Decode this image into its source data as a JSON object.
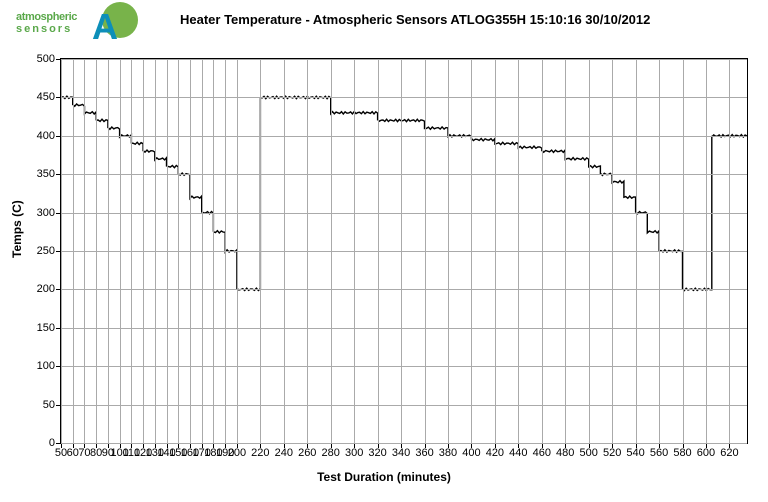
{
  "logo": {
    "word1": "atmospheric",
    "word2": "sensors",
    "letter": "A"
  },
  "chart_data": {
    "type": "line",
    "title": "Heater Temperature - Atmospheric Sensors ATLOG355H 15:10:16 30/10/2012",
    "xlabel": "Test Duration (minutes)",
    "ylabel": "Temps (C)",
    "xlim": [
      50,
      635
    ],
    "ylim": [
      0,
      500
    ],
    "x_ticks": [
      50,
      60,
      70,
      80,
      90,
      100,
      110,
      120,
      130,
      140,
      150,
      160,
      170,
      180,
      190,
      200,
      220,
      240,
      260,
      280,
      300,
      320,
      340,
      360,
      380,
      400,
      420,
      440,
      460,
      480,
      500,
      520,
      540,
      560,
      580,
      600,
      620
    ],
    "y_ticks": [
      0,
      50,
      100,
      150,
      200,
      250,
      300,
      350,
      400,
      450,
      500
    ],
    "grid": true,
    "series": [
      {
        "name": "Temp",
        "step_mode": true,
        "color": "#000000",
        "breakpoints": [
          {
            "x": 50,
            "y": 450
          },
          {
            "x": 60,
            "y": 440
          },
          {
            "x": 70,
            "y": 430
          },
          {
            "x": 80,
            "y": 420
          },
          {
            "x": 90,
            "y": 410
          },
          {
            "x": 100,
            "y": 400
          },
          {
            "x": 110,
            "y": 390
          },
          {
            "x": 120,
            "y": 380
          },
          {
            "x": 130,
            "y": 370
          },
          {
            "x": 140,
            "y": 360
          },
          {
            "x": 150,
            "y": 350
          },
          {
            "x": 160,
            "y": 320
          },
          {
            "x": 170,
            "y": 300
          },
          {
            "x": 180,
            "y": 275
          },
          {
            "x": 190,
            "y": 250
          },
          {
            "x": 200,
            "y": 200
          },
          {
            "x": 220,
            "y": 450
          },
          {
            "x": 280,
            "y": 430
          },
          {
            "x": 320,
            "y": 420
          },
          {
            "x": 360,
            "y": 410
          },
          {
            "x": 380,
            "y": 400
          },
          {
            "x": 400,
            "y": 395
          },
          {
            "x": 420,
            "y": 390
          },
          {
            "x": 440,
            "y": 385
          },
          {
            "x": 460,
            "y": 380
          },
          {
            "x": 480,
            "y": 370
          },
          {
            "x": 500,
            "y": 360
          },
          {
            "x": 510,
            "y": 350
          },
          {
            "x": 520,
            "y": 340
          },
          {
            "x": 530,
            "y": 320
          },
          {
            "x": 540,
            "y": 300
          },
          {
            "x": 550,
            "y": 275
          },
          {
            "x": 560,
            "y": 250
          },
          {
            "x": 580,
            "y": 200
          },
          {
            "x": 605,
            "y": 400
          },
          {
            "x": 635,
            "y": 400
          }
        ]
      }
    ]
  }
}
